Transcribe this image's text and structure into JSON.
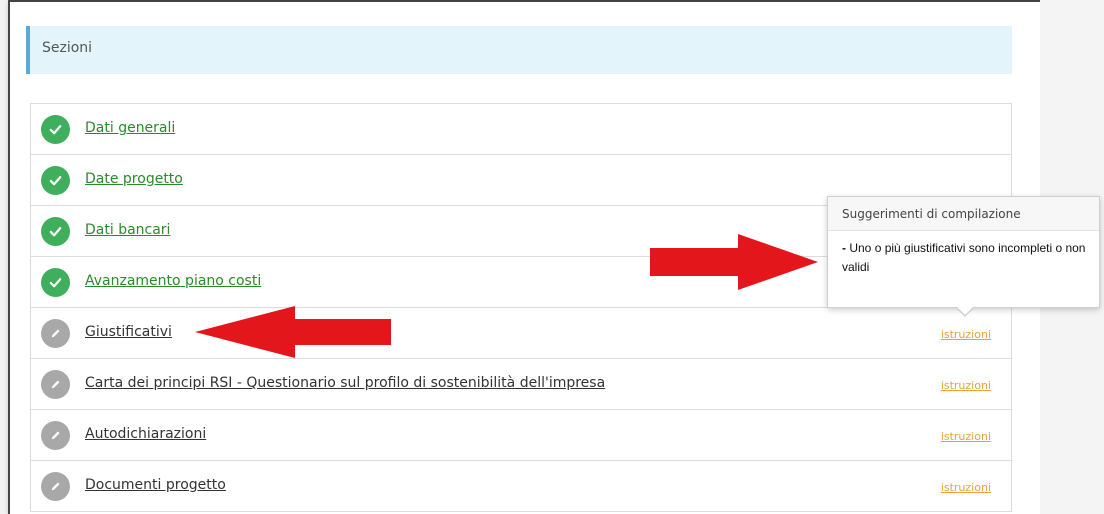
{
  "header": {
    "title": "Sezioni"
  },
  "rows": [
    {
      "label": "Dati generali",
      "status": "ok",
      "link": ""
    },
    {
      "label": "Date progetto",
      "status": "ok",
      "link": ""
    },
    {
      "label": "Dati bancari",
      "status": "ok",
      "link": ""
    },
    {
      "label": "Avanzamento piano costi",
      "status": "ok",
      "link": ""
    },
    {
      "label": "Giustificativi",
      "status": "todo",
      "link": "istruzioni"
    },
    {
      "label": "Carta dei principi RSI - Questionario sul profilo di sostenibilità dell'impresa",
      "status": "todo",
      "link": "istruzioni"
    },
    {
      "label": "Autodichiarazioni",
      "status": "todo",
      "link": "istruzioni"
    },
    {
      "label": "Documenti progetto",
      "status": "todo",
      "link": "istruzioni"
    }
  ],
  "tooltip": {
    "title": "Suggerimenti di compilazione",
    "dash": "-",
    "message": "Uno o più giustificativi sono incompleti o non validi"
  },
  "colors": {
    "ok": "#3fae5d",
    "todo": "#a8a8a8",
    "link_ok": "#2b8a2b",
    "istruzioni": "#e8a23a",
    "arrow": "#e3161b",
    "header_bg": "#e3f4fb",
    "header_border": "#5aa9d8"
  },
  "icons": {
    "ok": "check-icon",
    "todo": "pencil-icon"
  }
}
